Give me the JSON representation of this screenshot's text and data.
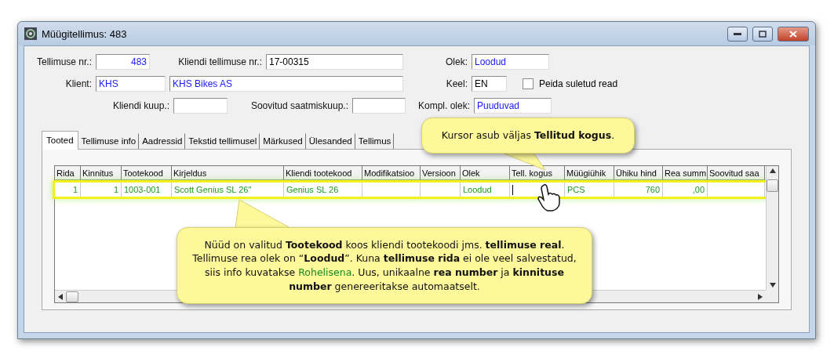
{
  "window": {
    "title": "Müügitellimus: 483"
  },
  "form": {
    "rows": [
      [
        {
          "label": "Tellimuse nr.:",
          "value": "483",
          "kind": "number"
        },
        {
          "label": "Kliendi tellimuse nr.:",
          "value": "17-00315",
          "kind": "plain"
        },
        {
          "label": "Olek:",
          "value": "Loodud",
          "kind": "link"
        }
      ],
      [
        {
          "label": "Klient:",
          "value": "KHS",
          "kind": "link"
        },
        {
          "value": "KHS Bikes AS",
          "kind": "link"
        },
        {
          "label": "Keel:",
          "value": "EN",
          "kind": "plain"
        }
      ],
      [
        {
          "label": "Kliendi kuup.:",
          "kind": "plain"
        },
        {
          "label": "Soovitud saatmiskuup.:",
          "kind": "plain"
        },
        {
          "label": "Kompl. olek:",
          "value": "Puuduvad",
          "kind": "link"
        }
      ]
    ],
    "hide_closed": {
      "label": "Peida suletud read",
      "checked": false
    }
  },
  "tabs": [
    {
      "label": "Tooted",
      "selected": true
    },
    {
      "label": "Tellimuse info",
      "selected": false
    },
    {
      "label": "Aadressid",
      "selected": false
    },
    {
      "label": "Tekstid tellimusel",
      "selected": false
    },
    {
      "label": "Märkused",
      "selected": false
    },
    {
      "label": "Ülesanded",
      "selected": false
    },
    {
      "label": "Tellimus",
      "selected": false
    }
  ],
  "table": {
    "columns": [
      "Rida",
      "Kinnitus",
      "Tootekood",
      "Kirjeldus",
      "Kliendi tootekood",
      "Modifikatsioo",
      "Versioon",
      "Olek",
      "Tell. kogus",
      "Müügiühik",
      "Ühiku hind",
      "Rea summ",
      "Soovitud saa"
    ],
    "rows": [
      {
        "cells": [
          "1",
          "1",
          "1003-001",
          "Scott Genius SL 26''",
          "Genius SL 26",
          "",
          "",
          "Loodud",
          "",
          "PCS",
          "760",
          ",00",
          ""
        ],
        "saved": false,
        "selected": true
      }
    ]
  },
  "callouts": [
    {
      "parts": [
        {
          "text": "Kursor asub väljas **Tellitud kogus**.",
          "kind": "plain"
        }
      ],
      "kind": "down"
    },
    {
      "parts": [
        {
          "text": "Nüüd on valitud **Tootekood** koos kliendi tootekoodi jms. **tellimuse real**. Tellimuse rea olek on “**Loodud**”.  Kuna **tellimuse rida** ei ole veel salvestatud, siis  info kuvatakse ",
          "kind": "plain"
        },
        {
          "text": "Rohelisena",
          "kind": "highlight"
        },
        {
          "text": ".  Uus, unikaalne **rea number** ja **kinnituse number** genereeritakse automaatselt.",
          "kind": "plain"
        }
      ],
      "kind": "up"
    }
  ]
}
